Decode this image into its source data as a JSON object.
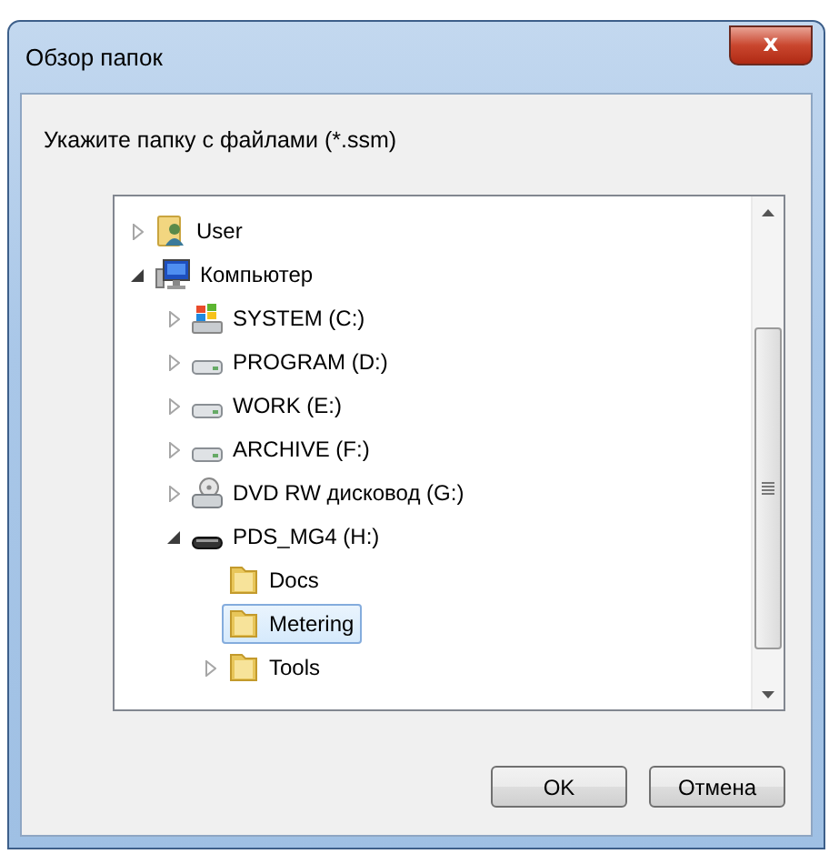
{
  "window": {
    "title": "Обзор папок",
    "close_label": "x"
  },
  "prompt": "Укажите папку с файлами (*.ssm)",
  "tree": [
    {
      "label": "User",
      "kind": "user",
      "expanded": false,
      "selected": false
    },
    {
      "label": "Компьютер",
      "kind": "computer",
      "expanded": true,
      "selected": false,
      "children": [
        {
          "label": "SYSTEM (C:)",
          "kind": "system",
          "expanded": false,
          "selected": false
        },
        {
          "label": "PROGRAM (D:)",
          "kind": "hdd",
          "expanded": false,
          "selected": false
        },
        {
          "label": "WORK (E:)",
          "kind": "hdd",
          "expanded": false,
          "selected": false
        },
        {
          "label": "ARCHIVE (F:)",
          "kind": "hdd",
          "expanded": false,
          "selected": false
        },
        {
          "label": "DVD RW дисковод (G:)",
          "kind": "dvd",
          "expanded": false,
          "selected": false
        },
        {
          "label": "PDS_MG4 (H:)",
          "kind": "removable",
          "expanded": true,
          "selected": false,
          "children": [
            {
              "label": "Docs",
              "kind": "folder",
              "selected": false
            },
            {
              "label": "Metering",
              "kind": "folder",
              "selected": true
            },
            {
              "label": "Tools",
              "kind": "folder",
              "expanded": false,
              "selected": false
            }
          ]
        }
      ]
    }
  ],
  "buttons": [
    {
      "label": "OK"
    },
    {
      "label": "Отмена"
    }
  ]
}
